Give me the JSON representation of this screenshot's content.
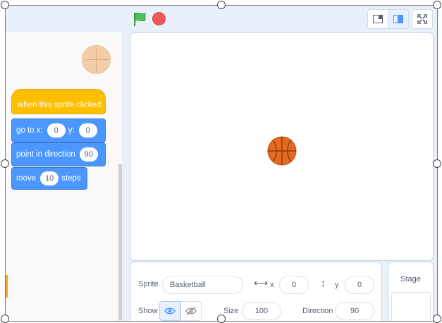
{
  "controls": {
    "green_flag_icon": "green-flag-icon",
    "stop_icon": "stop-icon",
    "small_stage_icon": "small-stage-icon",
    "large_stage_icon": "large-stage-icon",
    "fullscreen_icon": "fullscreen-icon"
  },
  "blocks": {
    "hat": {
      "label": "when this sprite clicked",
      "color": "#ffbf00"
    },
    "goto": {
      "label_x": "go to x:",
      "x": "0",
      "label_y": "y:",
      "y": "0"
    },
    "point": {
      "label": "point in direction",
      "value": "90"
    },
    "move": {
      "label": "move",
      "value": "10",
      "suffix": "steps"
    },
    "motion_color": "#4c97ff"
  },
  "sprite_info": {
    "sprite_label": "Sprite",
    "sprite_name": "Basketball",
    "x_label": "x",
    "x_value": "0",
    "y_label": "y",
    "y_value": "0",
    "show_label": "Show",
    "size_label": "Size",
    "size_value": "100",
    "direction_label": "Direction",
    "direction_value": "90"
  },
  "stage_pane": {
    "title": "Stage"
  },
  "colors": {
    "stop": "#ec5959",
    "flag": "#4cbf56",
    "accent": "#4c97ff",
    "ball": "#e56a1f"
  }
}
